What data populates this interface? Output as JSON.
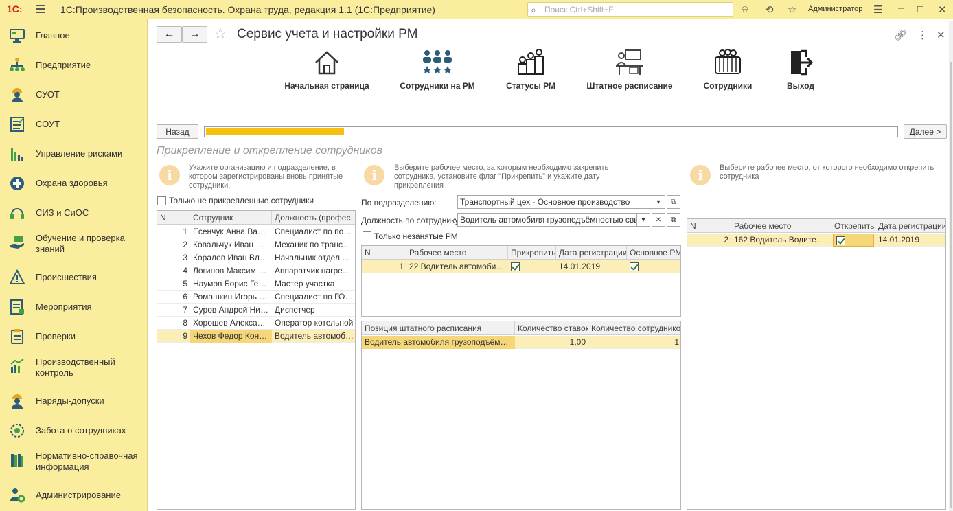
{
  "app": {
    "logo": "1С:",
    "title": "1С:Производственная безопасность. Охрана труда, редакция 1.1  (1С:Предприятие)",
    "search_placeholder": "Поиск Ctrl+Shift+F",
    "user": "Администратор"
  },
  "sidebar": {
    "items": [
      {
        "label": "Главное",
        "icon": "monitor-icon"
      },
      {
        "label": "Предприятие",
        "icon": "org-structure-icon"
      },
      {
        "label": "СУОТ",
        "icon": "worker-helmet-icon"
      },
      {
        "label": "СОУТ",
        "icon": "checklist-icon"
      },
      {
        "label": "Управление рисками",
        "icon": "risk-chart-icon"
      },
      {
        "label": "Охрана здоровья",
        "icon": "medical-cross-icon"
      },
      {
        "label": "СИЗ и СиОС",
        "icon": "headphones-icon"
      },
      {
        "label": "Обучение и проверка знаний",
        "icon": "hand-book-icon"
      },
      {
        "label": "Происшествия",
        "icon": "warning-triangle-icon"
      },
      {
        "label": "Мероприятия",
        "icon": "task-list-icon"
      },
      {
        "label": "Проверки",
        "icon": "clipboard-icon"
      },
      {
        "label": "Производственный контроль",
        "icon": "analytics-icon"
      },
      {
        "label": "Наряды-допуски",
        "icon": "permit-icon"
      },
      {
        "label": "Забота о сотрудниках",
        "icon": "care-icon"
      },
      {
        "label": "Нормативно-справочная информация",
        "icon": "books-icon"
      },
      {
        "label": "Администрирование",
        "icon": "admin-gear-icon"
      }
    ]
  },
  "page": {
    "title": "Сервис учета и настройки РМ",
    "tiles": [
      {
        "label": "Начальная страница",
        "icon": "home-icon"
      },
      {
        "label": "Сотрудники на РМ",
        "icon": "people-stars-icon"
      },
      {
        "label": "Статусы РМ",
        "icon": "status-people-icon"
      },
      {
        "label": "Штатное расписание",
        "icon": "workplace-icon"
      },
      {
        "label": "Сотрудники",
        "icon": "employees-icon"
      },
      {
        "label": "Выход",
        "icon": "exit-icon"
      }
    ],
    "back_label": "Назад",
    "next_label": "Далее >",
    "progress": 0.2,
    "section_title": "Прикрепление и открепление сотрудников"
  },
  "left": {
    "note": "Укажите организацию и подразделение, в котором зарегистрированы вновь принятые сотрудники.",
    "checkbox_label": "Только не прикрепленные сотрудники",
    "columns": [
      "N",
      "Сотрудник",
      "Должность (профес..."
    ],
    "rows": [
      {
        "n": "1",
        "name": "Есенчук Анна Валер...",
        "position": "Специалист по пожа..."
      },
      {
        "n": "2",
        "name": "Ковальчук Иван Оле...",
        "position": "Механик по трансп..."
      },
      {
        "n": "3",
        "name": "Коралев Иван Влад...",
        "position": "Начальник отдел Пж..."
      },
      {
        "n": "4",
        "name": "Логинов Максим Ф...",
        "position": "Аппаратчик нагрева ..."
      },
      {
        "n": "5",
        "name": "Наумов Борис Гера...",
        "position": "Мастер участка"
      },
      {
        "n": "6",
        "name": "Ромашкин Игорь Ев...",
        "position": "Специалист по ГО и ..."
      },
      {
        "n": "7",
        "name": "Суров Андрей Никол...",
        "position": "Диспетчер"
      },
      {
        "n": "8",
        "name": "Хорошев Александр...",
        "position": "Оператор котельной"
      },
      {
        "n": "9",
        "name": "Чехов Федор Кондр...",
        "position": "Водитель автомобил..."
      }
    ]
  },
  "middle": {
    "note": "Выберите рабочее место, за которым необходимо закрепить сотрудника, установите флаг \"Прикрепить\" и укажите дату прикрепления",
    "division_label": "По подразделению:",
    "division_value": "Транспортный цех - Основное производство",
    "position_label": "Должность по сотруднику:",
    "position_value": "Водитель автомобиля грузоподъёмностью свыше",
    "checkbox_label": "Только незанятые РМ",
    "columns": [
      "N",
      "Рабочее место",
      "Прикрепить",
      "Дата регистрации",
      "Основное РМ"
    ],
    "rows": [
      {
        "n": "1",
        "place": "22 Водитель автомобиля ...",
        "attach": true,
        "date": "14.01.2019",
        "main": true
      }
    ],
    "staff_columns": [
      "Позиция штатного расписания",
      "Количество ставок",
      "Количество сотрудников"
    ],
    "staff_rows": [
      {
        "position": "Водитель автомобиля грузоподъёмност...",
        "rates": "1,00",
        "count": "1"
      }
    ]
  },
  "right": {
    "note": "Выберите рабочее место, от которого необходимо открепить сотрудника",
    "columns": [
      "N",
      "Рабочее место",
      "Открепить",
      "Дата регистрации"
    ],
    "rows": [
      {
        "n": "2",
        "place": "162 Водитель Водитель а...",
        "detach": true,
        "date": "14.01.2019"
      }
    ]
  }
}
